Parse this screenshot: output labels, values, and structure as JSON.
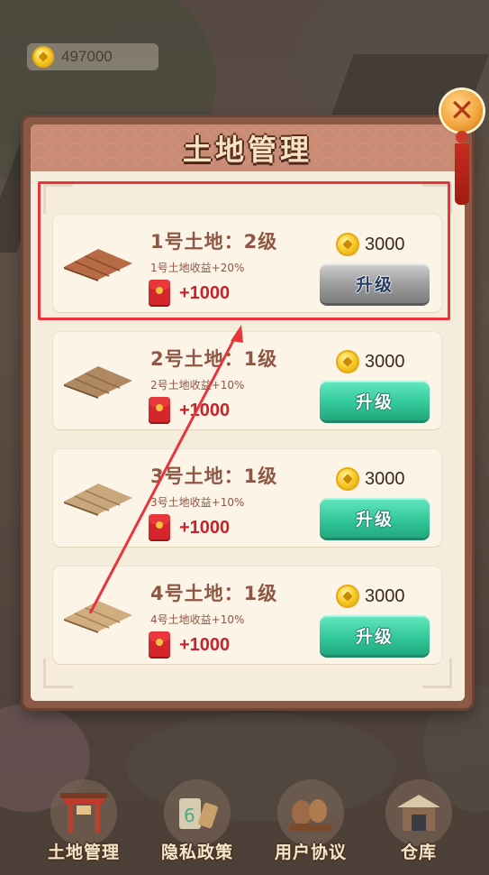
{
  "top_bar": {
    "coins": "497000"
  },
  "dialog": {
    "title": "土地管理",
    "lands": [
      {
        "title": "1号土地：2级",
        "subtitle": "1号土地收益+20%",
        "bonus": "+1000",
        "price": "3000",
        "button": "升级",
        "button_state": "disabled"
      },
      {
        "title": "2号土地：1级",
        "subtitle": "2号土地收益+10%",
        "bonus": "+1000",
        "price": "3000",
        "button": "升级",
        "button_state": "enabled"
      },
      {
        "title": "3号土地：1级",
        "subtitle": "3号土地收益+10%",
        "bonus": "+1000",
        "price": "3000",
        "button": "升级",
        "button_state": "enabled"
      },
      {
        "title": "4号土地：1级",
        "subtitle": "4号土地收益+10%",
        "bonus": "+1000",
        "price": "3000",
        "button": "升级",
        "button_state": "enabled"
      }
    ]
  },
  "bottom_nav": [
    {
      "label": "土地管理",
      "icon": "gate-icon"
    },
    {
      "label": "隐私政策",
      "icon": "scroll-icon"
    },
    {
      "label": "用户协议",
      "icon": "pottery-icon"
    },
    {
      "label": "仓库",
      "icon": "warehouse-icon"
    }
  ],
  "colors": {
    "highlight": "#e8343a",
    "accent_green": "#33c99a",
    "title_brown": "#8f5644",
    "bonus_red": "#c8232a"
  }
}
